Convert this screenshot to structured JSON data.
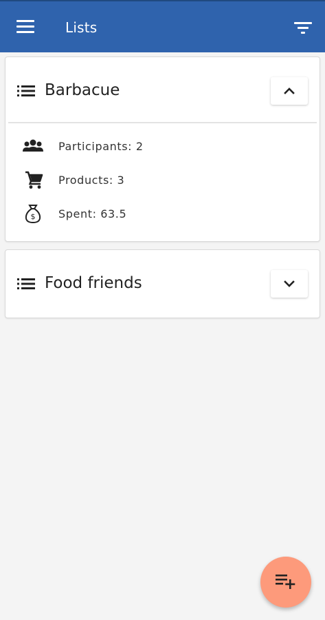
{
  "header": {
    "title": "Lists",
    "menu_icon": "menu-icon",
    "filter_icon": "filter-icon",
    "background_color": "#2f63ad"
  },
  "lists": [
    {
      "name": "Barbacue",
      "expanded": true,
      "toggle_icon": "chevron-up-icon",
      "stats": [
        {
          "icon": "participants-icon",
          "label": "Participants: 2"
        },
        {
          "icon": "cart-icon",
          "label": "Products: 3"
        },
        {
          "icon": "money-bag-icon",
          "label": "Spent: 63.5"
        }
      ]
    },
    {
      "name": "Food friends",
      "expanded": false,
      "toggle_icon": "chevron-down-icon"
    }
  ],
  "fab": {
    "icon": "playlist-add-icon",
    "color": "#fd9a7b"
  }
}
